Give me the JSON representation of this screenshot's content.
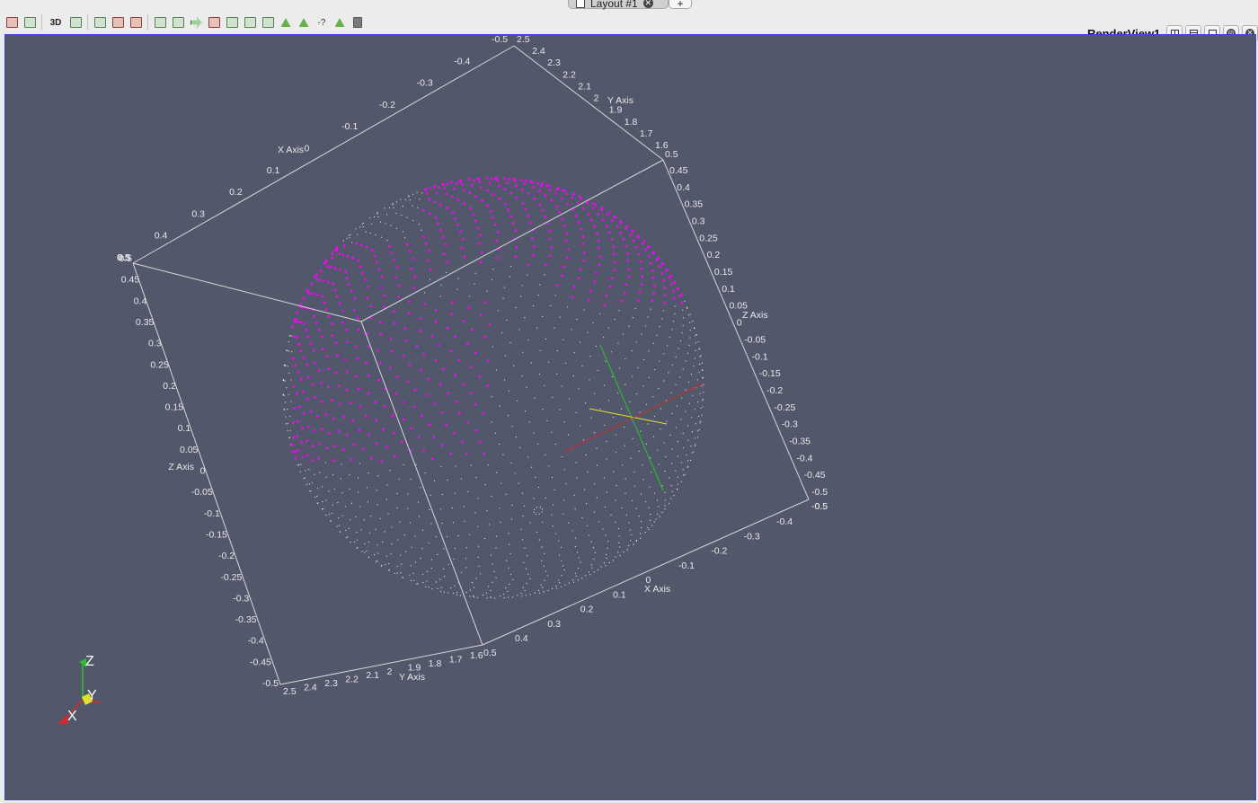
{
  "tabs": [
    {
      "label": "Layout #1"
    },
    {
      "label": "+"
    }
  ],
  "toolbar": {
    "three_d_label": "3D",
    "icons": [
      "reset-camera-icon",
      "zoom-to-data-icon",
      "toggle-3d",
      "capture-image-icon",
      "select-cells-on-icon",
      "select-points-on-icon",
      "select-cells-through-icon",
      "select-points-through-icon",
      "select-cells-polygon-icon",
      "select-points-polygon-icon",
      "interactive-select-cells-icon",
      "interactive-select-points-icon",
      "hover-points-icon",
      "hover-cells-icon",
      "grow-selection-icon",
      "shrink-selection-icon",
      "clear-selection-icon"
    ]
  },
  "render_view": {
    "title": "RenderView1",
    "background": "#52576b",
    "highlight_color": "#ff00ff",
    "point_color": "#ffffff"
  },
  "axes_grid": {
    "x_axis_title": "X Axis",
    "y_axis_title": "Y Axis",
    "z_axis_title": "Z Axis",
    "top_x_ticks": [
      "-0.5",
      "-0.4",
      "-0.3",
      "-0.2",
      "-0.1",
      "0",
      "0.1",
      "0.2",
      "0.3",
      "0.4",
      "0.5"
    ],
    "top_y_ticks": [
      "2.5",
      "2.4",
      "2.3",
      "2.2",
      "2.1",
      "2",
      "1.9",
      "1.8",
      "1.7",
      "1.6"
    ],
    "top_y_end": "0.5",
    "right_z_ticks": [
      "0.45",
      "0.4",
      "0.35",
      "0.3",
      "0.25",
      "0.2",
      "0.15",
      "0.1",
      "0.05",
      "0",
      "-0.05",
      "-0.1",
      "-0.15",
      "-0.2",
      "-0.25",
      "-0.3",
      "-0.35",
      "-0.4",
      "-0.45",
      "-0.5"
    ],
    "right_z_end": "-0.5",
    "left_z_ticks": [
      "0.5",
      "0.45",
      "0.4",
      "0.35",
      "0.3",
      "0.25",
      "0.2",
      "0.15",
      "0.1",
      "0.05",
      "0",
      "-0.05",
      "-0.1",
      "-0.15",
      "-0.2",
      "-0.25",
      "-0.3",
      "-0.35",
      "-0.4",
      "-0.45",
      "-0.5"
    ],
    "left_z_top": "0.5",
    "bottom_y_ticks": [
      "2.5",
      "2.4",
      "2.3",
      "2.2",
      "2.1",
      "2",
      "1.9",
      "1.8",
      "1.7",
      "1.6"
    ],
    "bottom_y_end": "0.5",
    "bottom_x_ticks": [
      "0.4",
      "0.3",
      "0.2",
      "0.1",
      "0",
      "-0.1",
      "-0.2",
      "-0.3",
      "-0.4"
    ],
    "bottom_x_end": "-0.5"
  },
  "orientation_axes": {
    "x": "X",
    "y": "Y",
    "z": "Z",
    "x_color": "#d42a2a",
    "y_color": "#e4e02e",
    "z_color": "#27c22a"
  }
}
